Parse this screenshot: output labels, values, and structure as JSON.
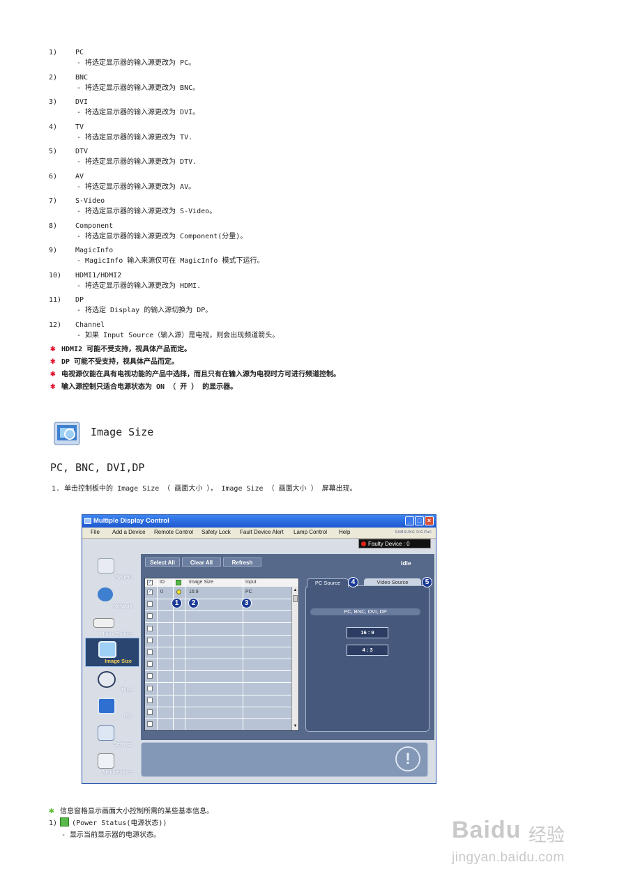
{
  "source_items": [
    {
      "num": "1)",
      "name": "PC",
      "desc": "- 将选定显示器的输入源更改为 PC。"
    },
    {
      "num": "2)",
      "name": "BNC",
      "desc": "- 将选定显示器的输入源更改为 BNC。"
    },
    {
      "num": "3)",
      "name": "DVI",
      "desc": "- 将选定显示器的输入源更改为 DVI。"
    },
    {
      "num": "4)",
      "name": "TV",
      "desc": "- 将选定显示器的输入源更改为 TV."
    },
    {
      "num": "5)",
      "name": "DTV",
      "desc": "- 将选定显示器的输入源更改为 DTV."
    },
    {
      "num": "6)",
      "name": "AV",
      "desc": "- 将选定显示器的输入源更改为 AV。"
    },
    {
      "num": "7)",
      "name": "S-Video",
      "desc": "- 将选定显示器的输入源更改为 S-Video。"
    },
    {
      "num": "8)",
      "name": "Component",
      "desc": "- 将选定显示器的输入源更改为 Component(分量)。"
    },
    {
      "num": "9)",
      "name": "MagicInfo",
      "desc": "- MagicInfo 输入来源仅可在 MagicInfo 模式下运行。"
    },
    {
      "num": "10)",
      "name": "HDMI1/HDMI2",
      "desc": "- 将选定显示器的输入源更改为 HDMI."
    },
    {
      "num": "11)",
      "name": "DP",
      "desc": "- 将选定 Display 的输入源切换为 DP。"
    },
    {
      "num": "12)",
      "name": "Channel",
      "desc": "- 如果 Input Source（输入源）是电视，则会出现频道箭头。"
    }
  ],
  "notes": [
    "HDMI2 可能不受支持，视具体产品而定。",
    "DP 可能不受支持，视具体产品而定。",
    "电视源仅能在具有电视功能的产品中选择，而且只有在输入源为电视时方可进行频道控制。",
    "输入源控制只适合电源状态为 ON （ 开 ） 的显示器。"
  ],
  "section": {
    "title": "Image Size",
    "subtitle": "PC, BNC, DVI,DP",
    "step": "1. 单击控制板中的 Image Size （ 画面大小 ）， Image Size （ 画面大小 ） 屏幕出现。"
  },
  "app": {
    "title": "Multiple Display Control",
    "menu": [
      "File",
      "Add a Device",
      "Remote Control",
      "Safety Lock",
      "Fault Device Alert",
      "Lamp Control",
      "Help"
    ],
    "brand": "SAMSUNG DIGITall",
    "faulty": "Faulty Device : 0",
    "buttons": {
      "select_all": "Select All",
      "clear_all": "Clear All",
      "refresh": "Refresh"
    },
    "status": "Idle",
    "nav": [
      "System",
      "Network",
      "Input Source",
      "Image Size",
      "Time",
      "PIP",
      "Settings",
      "Maintenance"
    ],
    "table": {
      "headers": {
        "id": "ID",
        "image_size": "Image Size",
        "input": "Input"
      },
      "row": {
        "id": "0",
        "image_size": "16:9",
        "input": "PC"
      }
    },
    "tabs": {
      "pc": "PC Source",
      "video": "Video Source"
    },
    "source_label": "PC, BNC, DVI, DP",
    "size_buttons": [
      "16 : 9",
      "4 : 3"
    ],
    "badges": [
      "1",
      "2",
      "3",
      "4",
      "5"
    ]
  },
  "footer": {
    "info": "信息窗格显示画面大小控制所需的某些基本信息。",
    "item_num": "1)",
    "item_label": "(Power Status(电源状态))",
    "item_desc": "- 显示当前显示器的电源状态。"
  },
  "watermark": {
    "brand": "Baidu",
    "cn": "经验",
    "url": "jingyan.baidu.com"
  },
  "colors": {
    "star_red": "#e0102c",
    "star_green": "#5fbe3c",
    "power_green": "#58b84a"
  }
}
